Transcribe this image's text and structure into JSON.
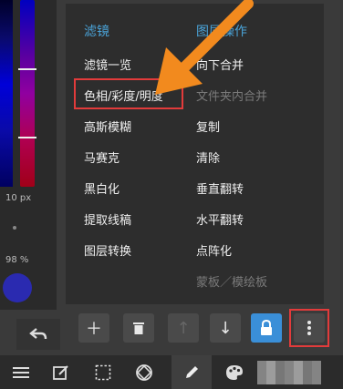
{
  "left_panel": {
    "brush_size": "10 px",
    "opacity": "98 %"
  },
  "menu": {
    "filters_header": "滤镜",
    "layer_ops_header": "图层操作",
    "filters": [
      {
        "label": "滤镜一览"
      },
      {
        "label": "色相/彩度/明度"
      },
      {
        "label": "高斯模糊"
      },
      {
        "label": "马赛克"
      },
      {
        "label": "黑白化"
      },
      {
        "label": "提取线稿"
      },
      {
        "label": "图层转换"
      }
    ],
    "layer_ops": [
      {
        "label": "向下合并",
        "enabled": true
      },
      {
        "label": "文件夹内合并",
        "enabled": false
      },
      {
        "label": "复制",
        "enabled": true
      },
      {
        "label": "清除",
        "enabled": true
      },
      {
        "label": "垂直翻转",
        "enabled": true
      },
      {
        "label": "水平翻转",
        "enabled": true
      },
      {
        "label": "点阵化",
        "enabled": true
      },
      {
        "label": "蒙板／模绘板",
        "enabled": false
      }
    ]
  },
  "colors": {
    "accent": "#4aa3d8",
    "highlight": "#e23b3b",
    "arrow": "#f28a1e",
    "lock": "#3a8fd8"
  }
}
